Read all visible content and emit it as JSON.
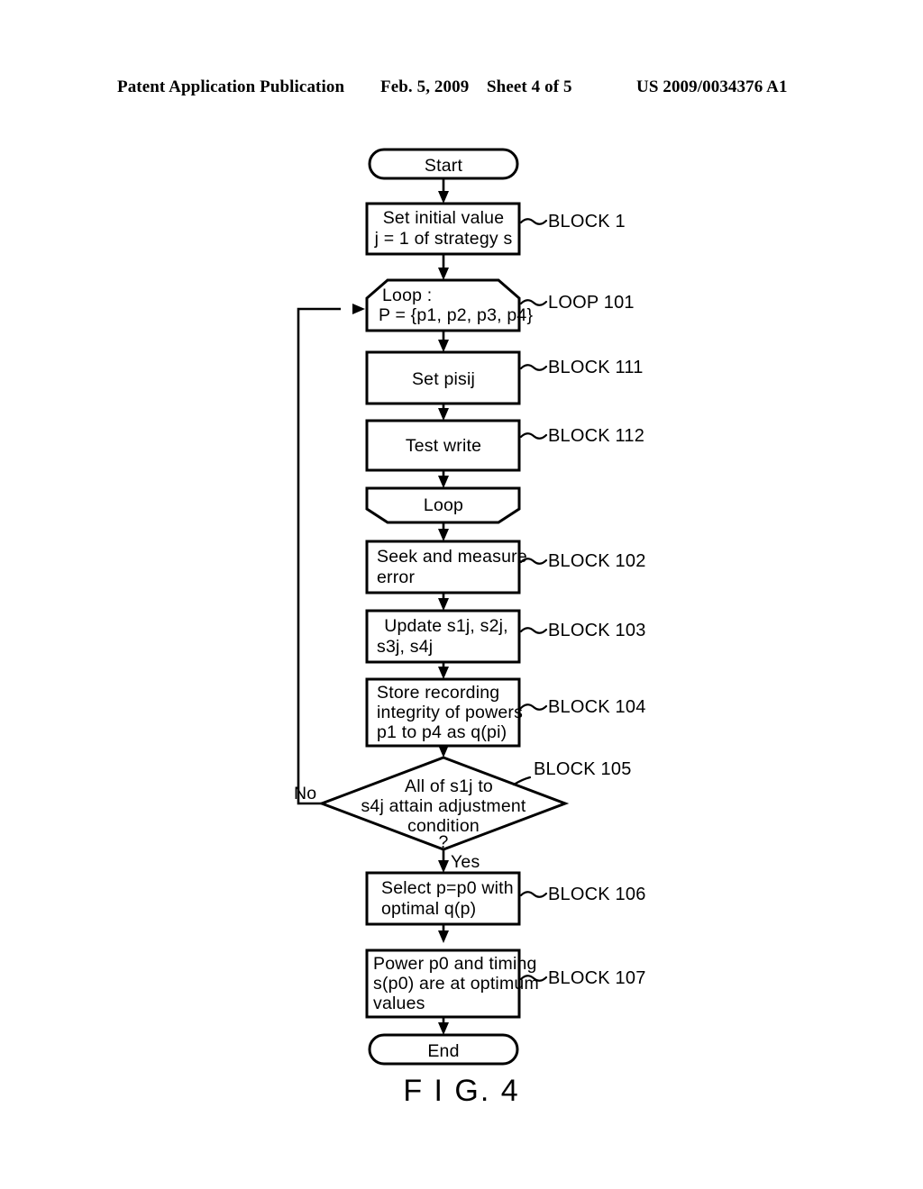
{
  "header": {
    "publication": "Patent Application Publication",
    "date": "Feb. 5, 2009",
    "sheet": "Sheet 4 of 5",
    "patent_number": "US 2009/0034376 A1"
  },
  "figure": {
    "caption": "F I G. 4",
    "ink_color": "#000000",
    "paper_color": "#ffffff"
  },
  "flow": {
    "start": {
      "text": "Start"
    },
    "block1": {
      "line1": "Set  initial  value",
      "line2": "j = 1  of  strategy  s",
      "label": "BLOCK 1"
    },
    "loop101": {
      "line1": "Loop :",
      "line2": "P = {p1, p2, p3, p4}",
      "label": "LOOP 101"
    },
    "block111": {
      "line1": "Set  pisij",
      "label": "BLOCK 111"
    },
    "block112": {
      "line1": "Test  write",
      "label": "BLOCK 112"
    },
    "loop_end": {
      "text": "Loop"
    },
    "block102": {
      "line1": "Seek  and  measure",
      "line2": "error",
      "label": "BLOCK 102"
    },
    "block103": {
      "line1": "Update  s1j,  s2j,",
      "line2": "s3j,  s4j",
      "label": "BLOCK 103"
    },
    "block104": {
      "line1": "Store  recording",
      "line2": "integrity  of  powers",
      "line3": "p1  to  p4  as  q(pi)",
      "label": "BLOCK 104"
    },
    "block105": {
      "line1": "All  of  s1j  to",
      "line2": "s4j attain adjustment",
      "line3": "condition",
      "line4": "?",
      "label": "BLOCK 105",
      "branch_no": "No",
      "branch_yes": "Yes"
    },
    "block106": {
      "line1": "Select  p=p0  with",
      "line2": "optimal  q(p)",
      "label": "BLOCK 106"
    },
    "block107": {
      "line1": "Power  p0  and  timing",
      "line2": "s(p0)  are  at  optimum",
      "line3": "values",
      "label": "BLOCK 107"
    },
    "end": {
      "text": "End"
    }
  }
}
